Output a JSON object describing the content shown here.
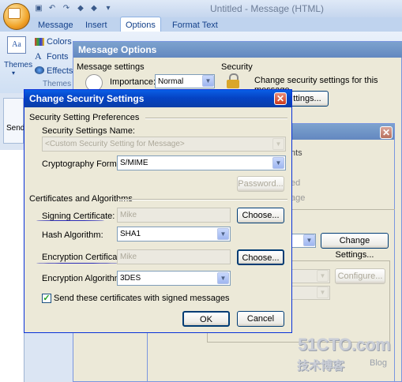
{
  "outlook": {
    "window_title": "Untitled - Message (HTML)",
    "tabs": [
      "Message",
      "Insert",
      "Options",
      "Format Text"
    ],
    "themes_label": "Themes",
    "colors_label": "Colors",
    "fonts_label": "Fonts",
    "effects_label": "Effects",
    "group_themes": "Themes",
    "send_label": "Send"
  },
  "message_options": {
    "title": "Message Options",
    "message_settings": "Message settings",
    "importance_label": "Importance:",
    "importance_value": "Normal",
    "security_heading": "Security",
    "security_text": "Change security settings for this message.",
    "security_button": "ttings...",
    "bg_text_1": "nts",
    "bg_text_2": "ed",
    "bg_text_3": "age",
    "change_settings_button": "Change Settings...",
    "configure_button": "Configure..."
  },
  "change_security": {
    "title": "Change Security Settings",
    "close": "✕",
    "section_prefs": "Security Setting Preferences",
    "settings_name_label": "Security Settings Name:",
    "settings_name_value": "<Custom Security Setting for Message>",
    "crypto_format_label": "Cryptography Format:",
    "crypto_format_value": "S/MIME",
    "password_button": "Password...",
    "section_certs": "Certificates and Algorithms",
    "signing_cert_label": "Signing Certificate:",
    "signing_cert_value": "Mike",
    "choose_button_1": "Choose...",
    "hash_label": "Hash Algorithm:",
    "hash_value": "SHA1",
    "encryption_cert_label": "Encryption Certificate:",
    "encryption_cert_value": "Mike",
    "choose_button_2": "Choose...",
    "encryption_algo_label": "Encryption Algorithm:",
    "encryption_algo_value": "3DES",
    "send_certs_label": "Send these certificates with signed messages",
    "send_certs_checked": true,
    "ok_button": "OK",
    "cancel_button": "Cancel"
  },
  "watermark": {
    "main": "51CTO.com",
    "sub": "技术博客",
    "blog": "Blog"
  }
}
